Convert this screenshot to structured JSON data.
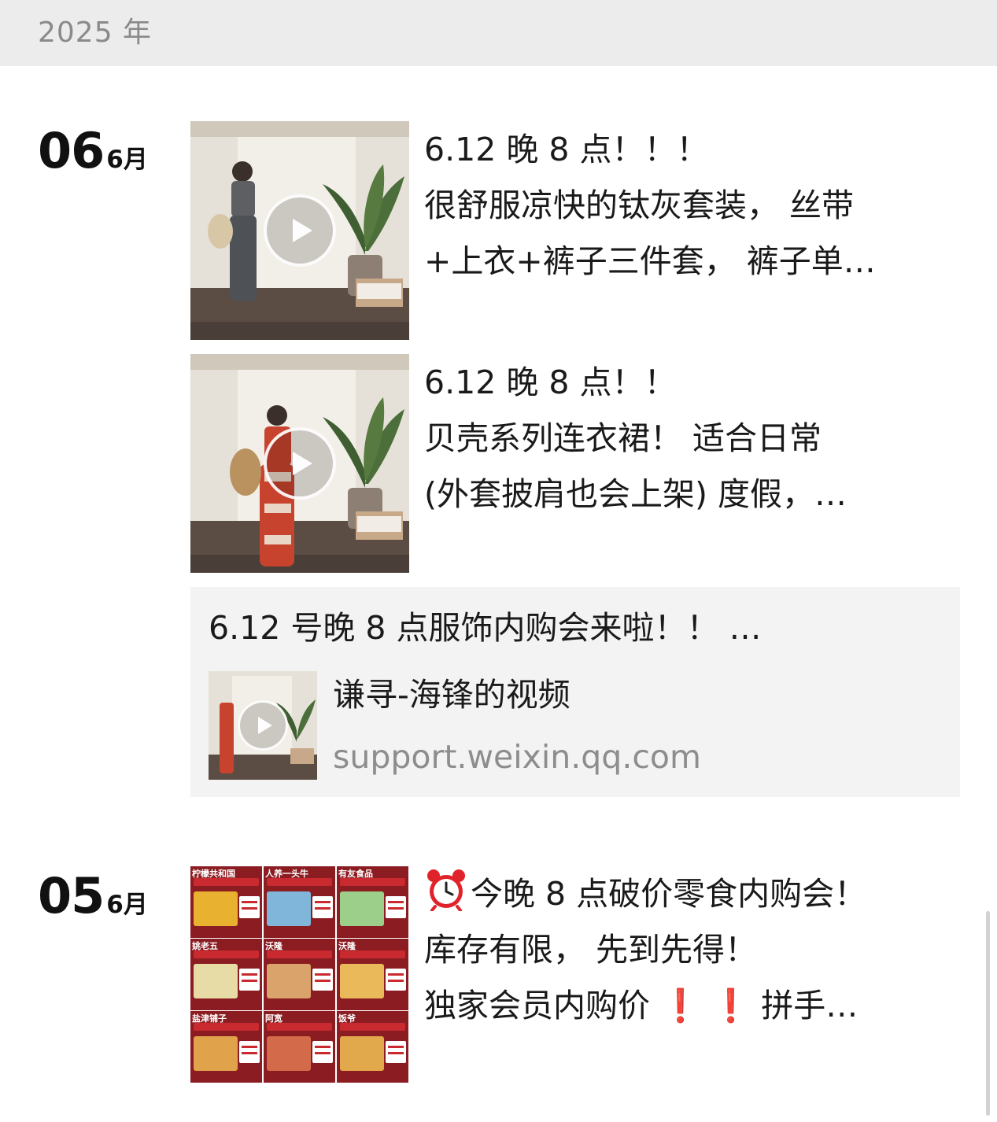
{
  "year_header": "2025 年",
  "groups": [
    {
      "day": "06",
      "month": "6月",
      "posts": [
        {
          "type": "video",
          "lines": [
            "6.12 晚 8 点！！！",
            "很舒服凉快的钛灰套装， 丝带",
            "+上衣+裤子三件套， 裤子单…"
          ]
        },
        {
          "type": "video",
          "lines": [
            "6.12 晚 8 点！！",
            "贝壳系列连衣裙！ 适合日常",
            "(外套披肩也会上架) 度假，…"
          ]
        },
        {
          "type": "share",
          "title": "6.12 号晚 8 点服饰内购会来啦！！ …",
          "source": "谦寻-海锋的视频",
          "url": "support.weixin.qq.com"
        }
      ]
    },
    {
      "day": "05",
      "month": "6月",
      "posts": [
        {
          "type": "image-grid",
          "icon": "alarm-clock-icon",
          "line1": "今晚 8 点破价零食内购会！",
          "line2": "库存有限， 先到先得！",
          "line3_text": "独家会员内购价",
          "line3_marks": [
            "❗",
            "❗"
          ],
          "line3_tail": "拼手…",
          "grid_brands": [
            "柠檬共和国",
            "人养一头牛",
            "有友食品",
            "姚老五",
            "沃隆",
            "沃隆",
            "盐津铺子",
            "阿宽",
            "饭爷"
          ]
        }
      ]
    }
  ],
  "colors": {
    "year_bar": "#ececec",
    "share_card": "#f3f3f3",
    "grid_red": "#8b1d22",
    "exclamation": "#e0232a"
  }
}
